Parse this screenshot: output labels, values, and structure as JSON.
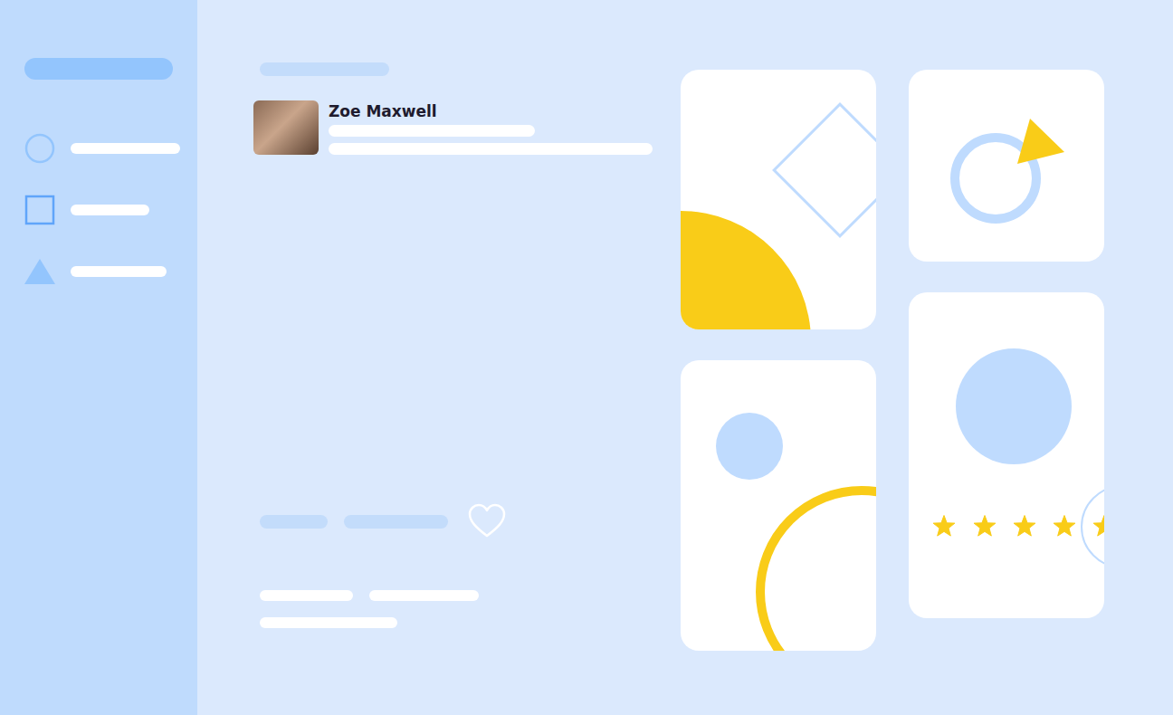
{
  "sidebar": {
    "items": [
      {
        "kind": "circle"
      },
      {
        "kind": "square"
      },
      {
        "kind": "triangle"
      }
    ]
  },
  "profile": {
    "name": "Zoe Maxwell"
  },
  "post": {
    "liked": false
  },
  "cards": [
    {
      "kind": "diamond"
    },
    {
      "kind": "ring"
    },
    {
      "kind": "arc"
    },
    {
      "kind": "rating",
      "stars": 5
    }
  ]
}
